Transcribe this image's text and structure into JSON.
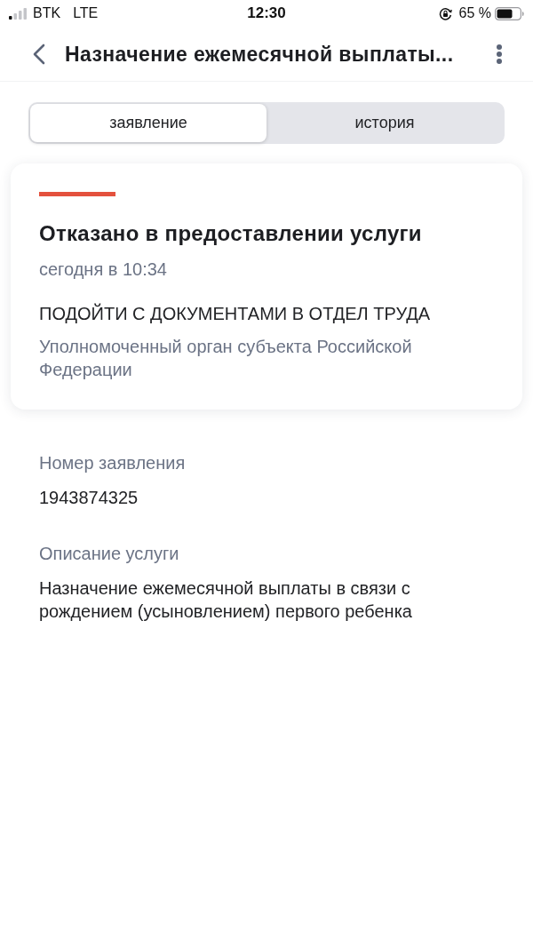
{
  "status_bar": {
    "carrier": "BTK",
    "network": "LTE",
    "time": "12:30",
    "battery": "65 %"
  },
  "header": {
    "title": "Назначение ежемесячной выплаты..."
  },
  "tabs": [
    {
      "label": "заявление",
      "selected": true
    },
    {
      "label": "история",
      "selected": false
    }
  ],
  "status_card": {
    "color": "#e4513d",
    "title": "Отказано в предоставлении услуги",
    "date": "сегодня в 10:34",
    "message": "ПОДОЙТИ С ДОКУМЕНТАМИ В ОТДЕЛ ТРУДА",
    "authority": "Уполномоченный орган субъекта Российской Федерации"
  },
  "details": [
    {
      "label": "Номер заявления",
      "value": "1943874325"
    },
    {
      "label": "Описание услуги",
      "value": "Назначение ежемесячной выплаты в связи с рождением (усыновлением) первого ребенка"
    }
  ]
}
